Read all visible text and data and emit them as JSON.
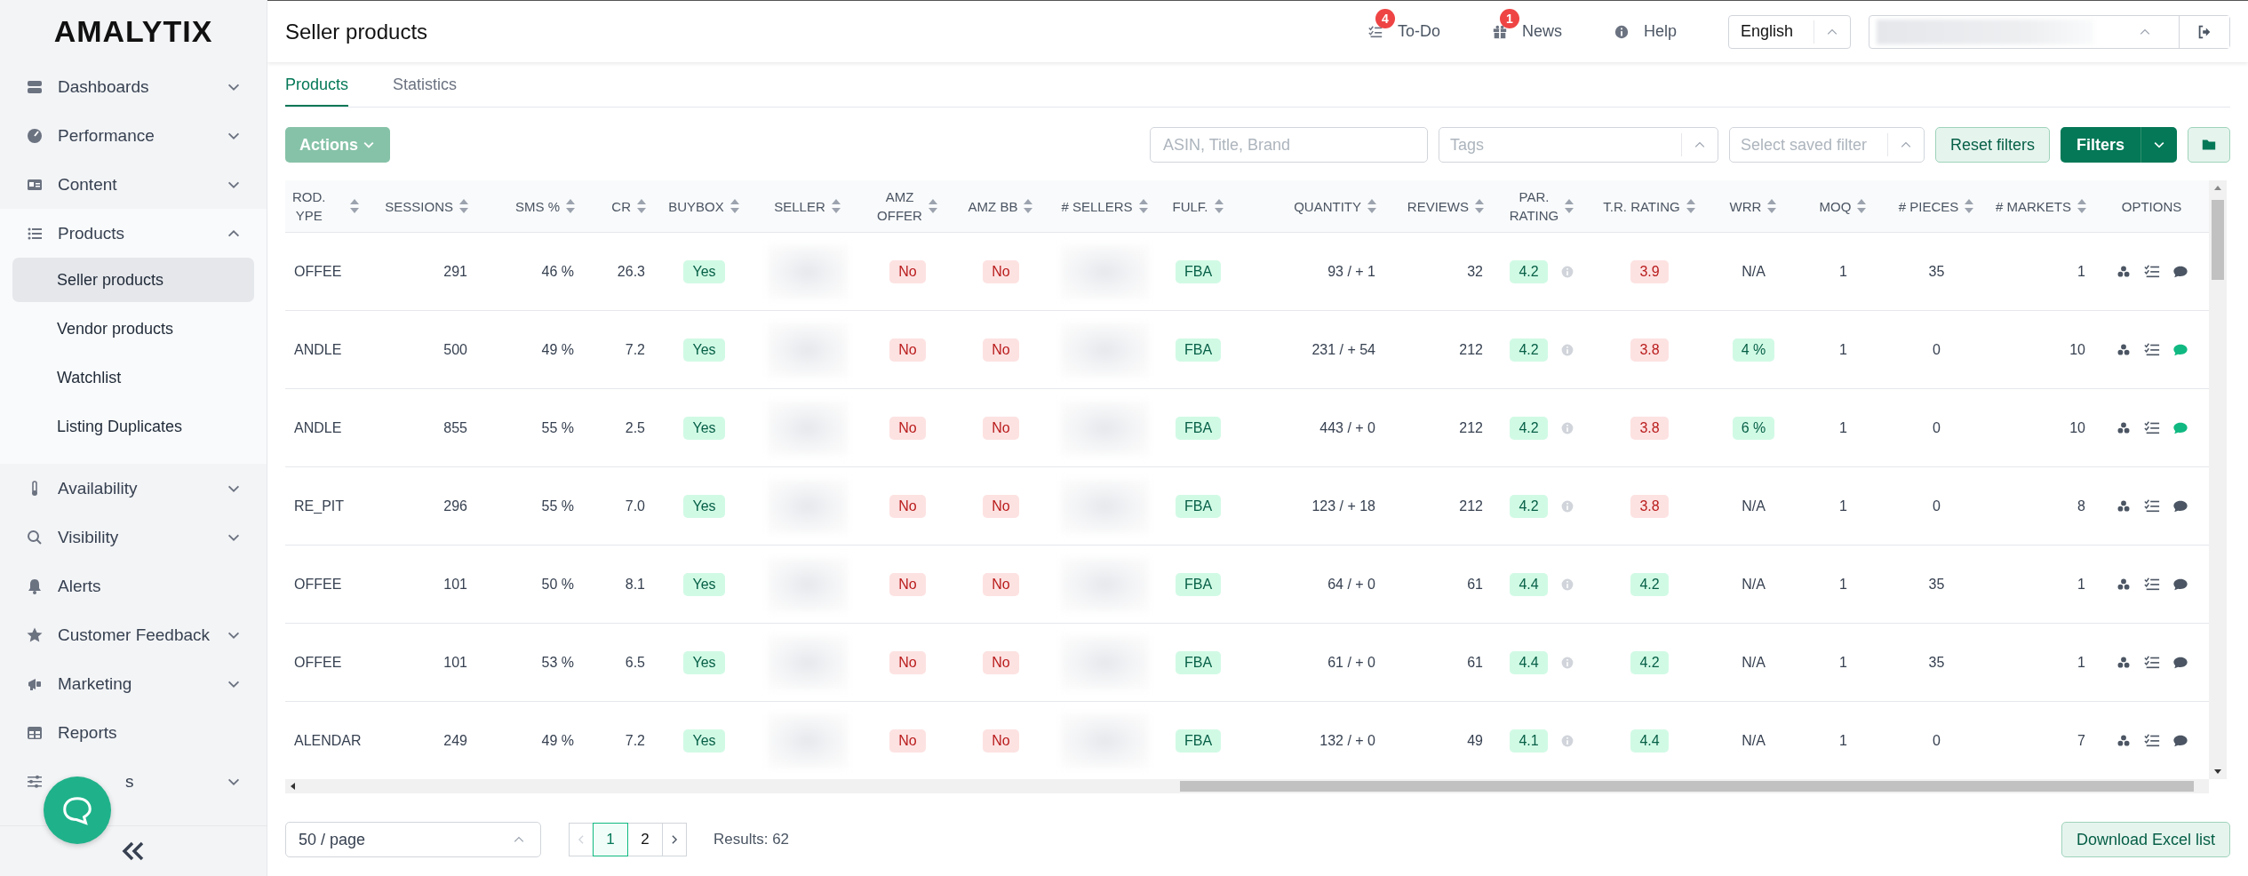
{
  "sidebar": {
    "logo": "AMALYTIX",
    "items": [
      {
        "label": "Dashboards",
        "expanded": false
      },
      {
        "label": "Performance",
        "expanded": false
      },
      {
        "label": "Content",
        "expanded": false
      },
      {
        "label": "Products",
        "expanded": true,
        "children": [
          {
            "label": "Seller products",
            "selected": true
          },
          {
            "label": "Vendor products",
            "selected": false
          },
          {
            "label": "Watchlist",
            "selected": false
          },
          {
            "label": "Listing Duplicates",
            "selected": false
          }
        ]
      },
      {
        "label": "Availability",
        "expanded": false
      },
      {
        "label": "Visibility",
        "expanded": false
      },
      {
        "label": "Alerts"
      },
      {
        "label": "Customer Feedback",
        "expanded": false
      },
      {
        "label": "Marketing",
        "expanded": false
      },
      {
        "label": "Reports"
      },
      {
        "label": "s",
        "expanded": false,
        "covered": true
      }
    ]
  },
  "header": {
    "title": "Seller products",
    "links": [
      {
        "label": "To-Do",
        "badge": "4"
      },
      {
        "label": "News",
        "badge": "1"
      },
      {
        "label": "Help"
      }
    ],
    "language": "English"
  },
  "tabs": [
    {
      "label": "Products",
      "selected": true
    },
    {
      "label": "Statistics",
      "selected": false
    }
  ],
  "toolbar": {
    "actions": {
      "label": "Actions",
      "disabled": true
    },
    "search": {
      "placeholder": "ASIN, Title, Brand"
    },
    "tags": {
      "placeholder": "Tags"
    },
    "saved_filter": {
      "placeholder": "Select saved filter"
    },
    "reset": "Reset filters",
    "filters": "Filters"
  },
  "table": {
    "columns": [
      {
        "label": "ROD.\nYPE",
        "kind": "text"
      },
      {
        "label": "SESSIONS",
        "kind": "number"
      },
      {
        "label": "SMS %",
        "kind": "number"
      },
      {
        "label": "CR",
        "kind": "number"
      },
      {
        "label": "BUYBOX",
        "kind": "badge"
      },
      {
        "label": "SELLER",
        "kind": "blurred"
      },
      {
        "label": "AMZ\nOFFER",
        "kind": "badge"
      },
      {
        "label": "AMZ BB",
        "kind": "badge"
      },
      {
        "label": "# SELLERS",
        "kind": "blurred"
      },
      {
        "label": "FULF.",
        "kind": "badge"
      },
      {
        "label": "QUANTITY",
        "kind": "number"
      },
      {
        "label": "REVIEWS",
        "kind": "number"
      },
      {
        "label": "PAR.\nRATING",
        "kind": "rating"
      },
      {
        "label": "T.R. RATING",
        "kind": "badge"
      },
      {
        "label": "WRR",
        "kind": "badge"
      },
      {
        "label": "MOQ",
        "kind": "center"
      },
      {
        "label": "# PIECES",
        "kind": "center"
      },
      {
        "label": "# MARKETS",
        "kind": "number"
      },
      {
        "label": "OPTIONS",
        "kind": "options"
      }
    ],
    "rows": [
      {
        "cells": [
          "OFFEE",
          "291",
          "46 %",
          "26.3",
          {
            "text": "Yes",
            "positive": true
          },
          "",
          {
            "text": "No",
            "positive": false
          },
          {
            "text": "No",
            "positive": false
          },
          "",
          {
            "text": "FBA",
            "positive": true
          },
          "93 / + 1",
          "32",
          {
            "text": "4.2",
            "positive": true
          },
          {
            "text": "3.9",
            "positive": false
          },
          "N/A",
          "1",
          "35",
          "1"
        ],
        "has_comments": false
      },
      {
        "cells": [
          "ANDLE",
          "500",
          "49 %",
          "7.2",
          {
            "text": "Yes",
            "positive": true
          },
          "",
          {
            "text": "No",
            "positive": false
          },
          {
            "text": "No",
            "positive": false
          },
          "",
          {
            "text": "FBA",
            "positive": true
          },
          "231 / + 54",
          "212",
          {
            "text": "4.2",
            "positive": true
          },
          {
            "text": "3.8",
            "positive": false
          },
          {
            "text": "4 %",
            "positive": true
          },
          "1",
          "0",
          "10"
        ],
        "has_comments": true
      },
      {
        "cells": [
          "ANDLE",
          "855",
          "55 %",
          "2.5",
          {
            "text": "Yes",
            "positive": true
          },
          "",
          {
            "text": "No",
            "positive": false
          },
          {
            "text": "No",
            "positive": false
          },
          "",
          {
            "text": "FBA",
            "positive": true
          },
          "443 / + 0",
          "212",
          {
            "text": "4.2",
            "positive": true
          },
          {
            "text": "3.8",
            "positive": false
          },
          {
            "text": "6 %",
            "positive": true
          },
          "1",
          "0",
          "10"
        ],
        "has_comments": true
      },
      {
        "cells": [
          "RE_PIT",
          "296",
          "55 %",
          "7.0",
          {
            "text": "Yes",
            "positive": true
          },
          "",
          {
            "text": "No",
            "positive": false
          },
          {
            "text": "No",
            "positive": false
          },
          "",
          {
            "text": "FBA",
            "positive": true
          },
          "123 / + 18",
          "212",
          {
            "text": "4.2",
            "positive": true
          },
          {
            "text": "3.8",
            "positive": false
          },
          "N/A",
          "1",
          "0",
          "8"
        ],
        "has_comments": false
      },
      {
        "cells": [
          "OFFEE",
          "101",
          "50 %",
          "8.1",
          {
            "text": "Yes",
            "positive": true
          },
          "",
          {
            "text": "No",
            "positive": false
          },
          {
            "text": "No",
            "positive": false
          },
          "",
          {
            "text": "FBA",
            "positive": true
          },
          "64 / + 0",
          "61",
          {
            "text": "4.4",
            "positive": true
          },
          {
            "text": "4.2",
            "positive": true
          },
          "N/A",
          "1",
          "35",
          "1"
        ],
        "has_comments": false
      },
      {
        "cells": [
          "OFFEE",
          "101",
          "53 %",
          "6.5",
          {
            "text": "Yes",
            "positive": true
          },
          "",
          {
            "text": "No",
            "positive": false
          },
          {
            "text": "No",
            "positive": false
          },
          "",
          {
            "text": "FBA",
            "positive": true
          },
          "61 / + 0",
          "61",
          {
            "text": "4.4",
            "positive": true
          },
          {
            "text": "4.2",
            "positive": true
          },
          "N/A",
          "1",
          "35",
          "1"
        ],
        "has_comments": false
      },
      {
        "cells": [
          "ALENDAR",
          "249",
          "49 %",
          "7.2",
          {
            "text": "Yes",
            "positive": true
          },
          "",
          {
            "text": "No",
            "positive": false
          },
          {
            "text": "No",
            "positive": false
          },
          "",
          {
            "text": "FBA",
            "positive": true
          },
          "132 / + 0",
          "49",
          {
            "text": "4.1",
            "positive": true
          },
          {
            "text": "4.4",
            "positive": true
          },
          "N/A",
          "1",
          "0",
          "7"
        ],
        "has_comments": false
      }
    ]
  },
  "footer": {
    "page_size": "50 / page",
    "prev_disabled": true,
    "next_disabled": false,
    "pages": [
      {
        "label": "1",
        "selected": true
      },
      {
        "label": "2",
        "selected": false
      }
    ],
    "results": "Results: 62",
    "download": "Download Excel list"
  }
}
